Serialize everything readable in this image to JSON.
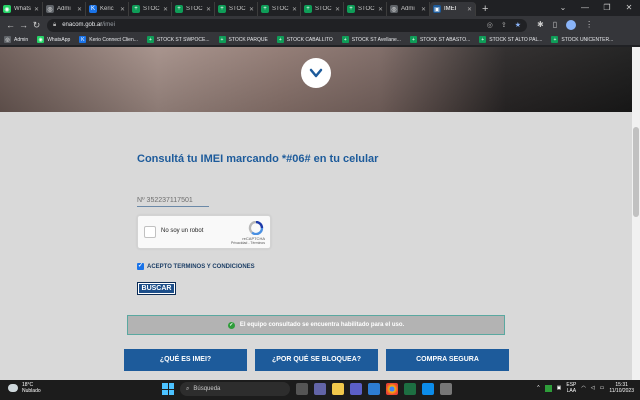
{
  "browser": {
    "tabs": [
      {
        "label": "Whats",
        "color": "#25d366",
        "glyph": "◉"
      },
      {
        "label": "Admi",
        "color": "#5f6368",
        "glyph": "◎"
      },
      {
        "label": "Keric",
        "color": "#1a73e8",
        "glyph": "K"
      },
      {
        "label": "STOC",
        "color": "#0f9d58",
        "glyph": "+"
      },
      {
        "label": "STOC",
        "color": "#0f9d58",
        "glyph": "+"
      },
      {
        "label": "STOC",
        "color": "#0f9d58",
        "glyph": "+"
      },
      {
        "label": "STOC",
        "color": "#0f9d58",
        "glyph": "+"
      },
      {
        "label": "STOC",
        "color": "#0f9d58",
        "glyph": "+"
      },
      {
        "label": "STOC",
        "color": "#0f9d58",
        "glyph": "+"
      },
      {
        "label": "Admi",
        "color": "#5f6368",
        "glyph": "◎"
      },
      {
        "label": "IMEI",
        "color": "#1d5b9b",
        "glyph": "▣",
        "active": true
      }
    ],
    "new_tab": "+",
    "url_host": "enacom.gob.ar",
    "url_path": "/imei",
    "bookmarks": [
      {
        "label": "Admin",
        "color": "#5f6368",
        "glyph": "◎"
      },
      {
        "label": "WhatsApp",
        "color": "#25d366",
        "glyph": "◉"
      },
      {
        "label": "Kerio Connect Clien...",
        "color": "#1a73e8",
        "glyph": "K"
      },
      {
        "label": "STOCK ST SWPOCE...",
        "color": "#0f9d58",
        "glyph": "+"
      },
      {
        "label": "STOCK PARQUE",
        "color": "#0f9d58",
        "glyph": "+"
      },
      {
        "label": "STOCK CABALLITO",
        "color": "#0f9d58",
        "glyph": "+"
      },
      {
        "label": "STOCK ST Avellane...",
        "color": "#0f9d58",
        "glyph": "+"
      },
      {
        "label": "STOCK ST ABASTO...",
        "color": "#0f9d58",
        "glyph": "+"
      },
      {
        "label": "STOCK ST ALTO PAL...",
        "color": "#0f9d58",
        "glyph": "+"
      },
      {
        "label": "STOCK UNICENTER...",
        "color": "#0f9d58",
        "glyph": "+"
      }
    ]
  },
  "page": {
    "headline": "Consultá tu IMEI marcando *#06# en tu celular",
    "imei_value": "Nº 352237117501",
    "recaptcha_label": "No soy un robot",
    "recaptcha_brand": "reCAPTCHA",
    "recaptcha_terms": "Privacidad - Términos",
    "accept_label": "ACEPTO TERMINOS Y CONDICIONES",
    "search_button": "BUSCAR",
    "result_message": "El equipo consultado se encuentra habilitado para el uso.",
    "btn_what_is": "¿QUÉ ES IMEI?",
    "btn_why_block": "¿POR QUÉ SE BLOQUEA?",
    "btn_safe_buy": "COMPRA SEGURA"
  },
  "taskbar": {
    "temp": "18°C",
    "weather": "Nublado",
    "search_placeholder": "Búsqueda",
    "lang1": "ESP",
    "lang2": "LAA",
    "time": "15:31",
    "date": "11/10/2023"
  },
  "colors": {
    "accent": "#1d5b9b",
    "success": "#2e9d3a"
  }
}
